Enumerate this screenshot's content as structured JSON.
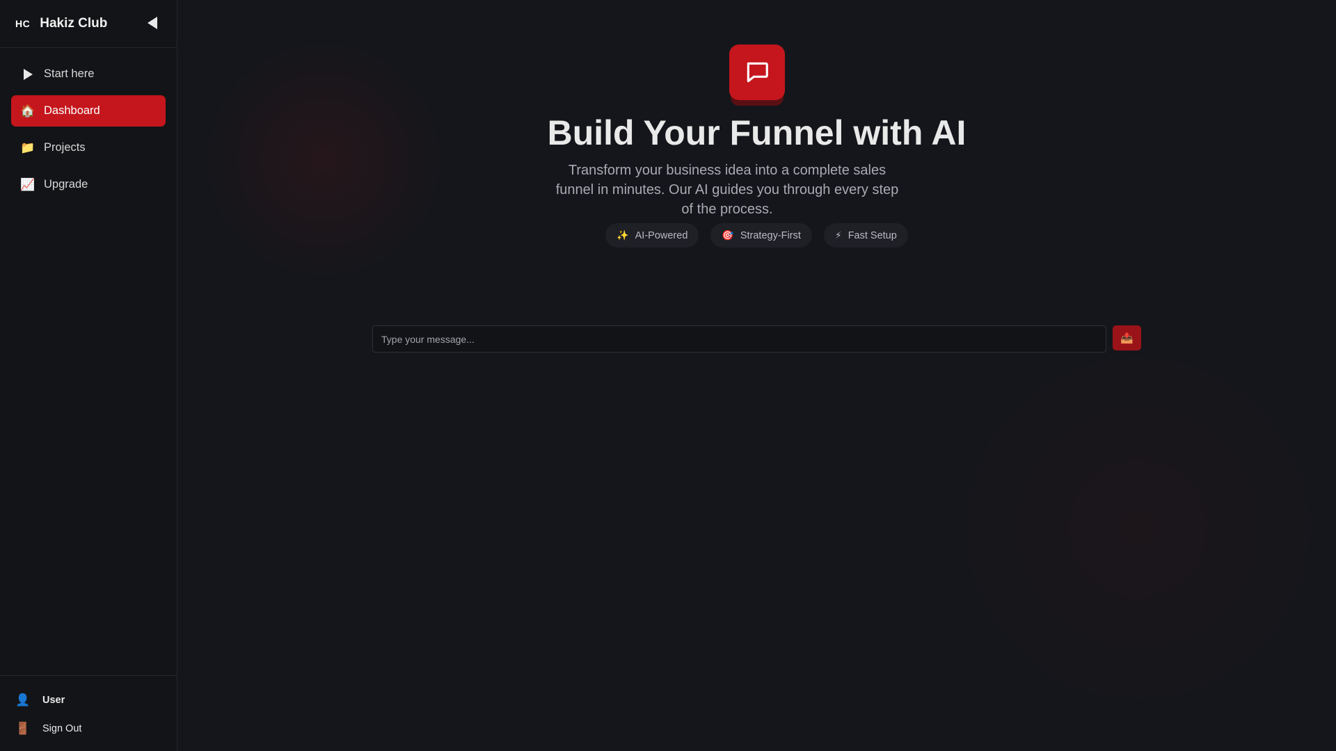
{
  "brand": {
    "logo": "HC",
    "name": "Hakiz Club"
  },
  "nav": {
    "items": [
      {
        "label": "Start here",
        "icon": "play-icon"
      },
      {
        "label": "Dashboard",
        "icon": "house-icon",
        "emoji": "🏠",
        "active": true
      },
      {
        "label": "Projects",
        "icon": "folder-icon",
        "emoji": "📁"
      },
      {
        "label": "Upgrade",
        "icon": "chart-increasing-icon",
        "emoji": "📈"
      }
    ]
  },
  "footer": {
    "user_label": "User",
    "user_emoji": "👤",
    "signout_label": "Sign Out",
    "signout_emoji": "🚪"
  },
  "hero": {
    "title": "Build Your Funnel with AI",
    "subtitle": "Transform your business idea into a complete sales funnel in minutes. Our AI guides you through every step of the process.",
    "chips": [
      {
        "emoji": "✨",
        "label": "AI-Powered",
        "icon": "sparkles-icon"
      },
      {
        "emoji": "🎯",
        "label": "Strategy-First",
        "icon": "target-icon"
      },
      {
        "emoji": "⚡",
        "label": "Fast Setup",
        "icon": "lightning-icon"
      }
    ]
  },
  "chat": {
    "placeholder": "Type your message...",
    "send_emoji": "📤"
  },
  "colors": {
    "accent": "#c4161c",
    "background": "#15161b",
    "sidebar": "#131417"
  }
}
